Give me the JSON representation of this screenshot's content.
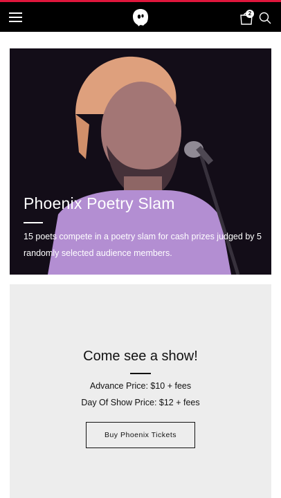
{
  "colors": {
    "accent": "#e0163c",
    "header_bg": "#000000",
    "card_bg": "#ededed",
    "hero_overlay": "#b48cd2"
  },
  "header": {
    "menu_icon": "hamburger-menu-icon",
    "logo_icon": "ghost-logo-icon",
    "cart_icon": "shopping-bag-icon",
    "cart_count": "2",
    "search_icon": "search-icon"
  },
  "hero": {
    "title": "Phoenix Poetry Slam",
    "description": "15 poets compete in a poetry slam for cash prizes judged by 5 randomly selected audience members."
  },
  "show": {
    "title": "Come see a show!",
    "advance_price": "Advance Price: $10 + fees",
    "day_of_show_price": "Day Of Show Price: $12 + fees",
    "button_label": "Buy Phoenix Tickets"
  }
}
